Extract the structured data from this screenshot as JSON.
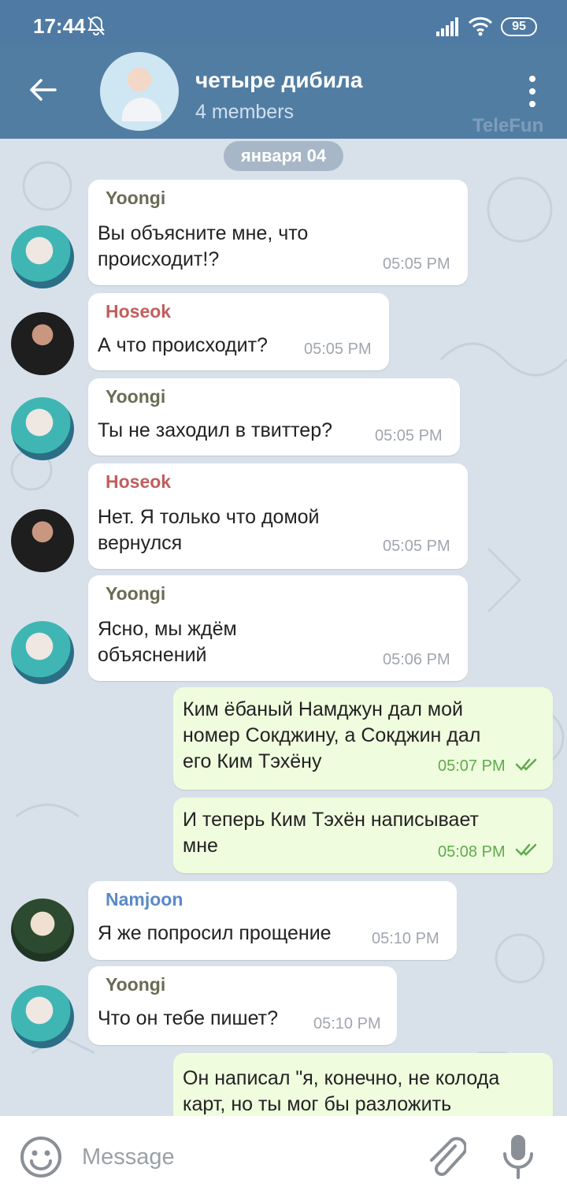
{
  "status_bar": {
    "time": "17:44",
    "battery": "95",
    "icons": [
      "bell-off-icon",
      "signal-icon",
      "wifi-icon",
      "battery-icon"
    ]
  },
  "header": {
    "title": "четыре дибила",
    "subtitle": "4 members",
    "watermark": "TeleFun",
    "icons": [
      "back-arrow-icon",
      "more-vert-icon"
    ]
  },
  "chat": {
    "date": "января 04",
    "messages": [
      {
        "sender": "Yoongi",
        "text": "Вы объясните мне, что\nпроисходит!?",
        "time": "05:05 PM"
      },
      {
        "sender": "Hoseok",
        "text": "А что происходит?",
        "time": "05:05 PM"
      },
      {
        "sender": "Yoongi",
        "text": "Ты не заходил в твиттер?",
        "time": "05:05 PM"
      },
      {
        "sender": "Hoseok",
        "text": "Нет. Я только что домой\nвернулся",
        "time": "05:05 PM"
      },
      {
        "sender": "Yoongi",
        "text": "Ясно, мы ждём\nобъяснений",
        "time": "05:06 PM"
      },
      {
        "sender": "",
        "text": "Ким ёбаный Намджун дал мой\nномер Сокджину, а Сокджин дал\nего Ким Тэхёну",
        "time": "05:07 PM"
      },
      {
        "sender": "",
        "text": "И теперь Ким Тэхён написывает\nмне",
        "time": "05:08 PM"
      },
      {
        "sender": "Namjoon",
        "text": "Я же попросил прощение",
        "time": "05:10 PM"
      },
      {
        "sender": "Yoongi",
        "text": "Что он тебе пишет?",
        "time": "05:10 PM"
      },
      {
        "sender": "",
        "text": "Он написал \"я, конечно, не колода\nкарт, но ты мог бы разложить",
        "time": ""
      }
    ]
  },
  "composer": {
    "placeholder": "Message",
    "icons": [
      "emoji-icon",
      "attach-icon",
      "mic-icon"
    ]
  },
  "colors": {
    "header": "#527da3",
    "incoming_bubble": "#ffffff",
    "outgoing_bubble": "#effdde",
    "yoongi": "#6b6b55",
    "hoseok": "#c25e5e",
    "namjoon": "#5a8ac6"
  }
}
